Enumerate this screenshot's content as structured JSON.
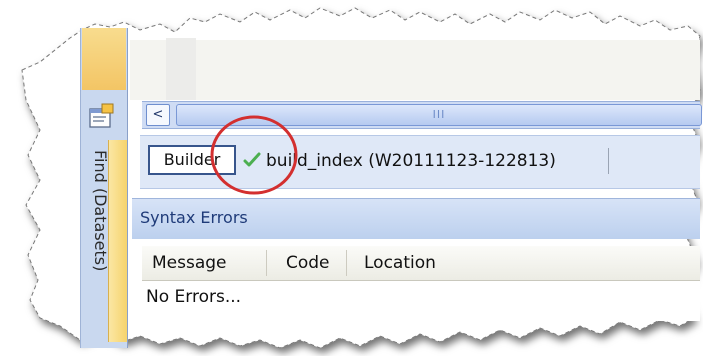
{
  "dock": {
    "label": "Find (Datasets)",
    "icon": "properties-window-icon"
  },
  "scrollbar": {
    "left_arrow": "<",
    "thumb_grip": "III"
  },
  "toolbar": {
    "builder_label": "Builder",
    "status_icon": "green-check-icon",
    "build_label": "build_index (W20111123-122813)"
  },
  "syntax_panel": {
    "title": "Syntax Errors",
    "columns": [
      "Message",
      "Code",
      "Location"
    ],
    "rows": [
      "No Errors..."
    ]
  },
  "colors": {
    "panel_title": "#1f3b79",
    "highlight_circle": "#d32f2f",
    "check": "#4caf50",
    "dock_tab": "#f6d36c"
  }
}
